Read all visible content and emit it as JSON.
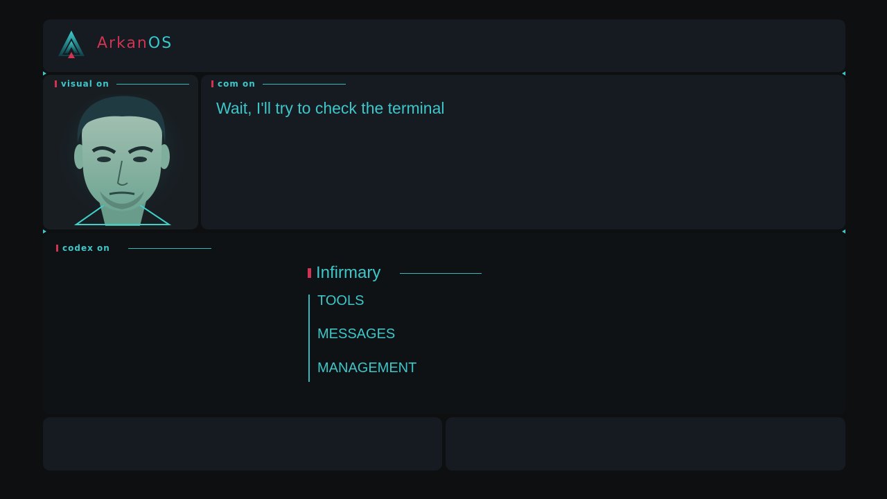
{
  "app": {
    "brand_part1": "Arkan",
    "brand_part2": "OS"
  },
  "panels": {
    "visual": {
      "label": "visual on"
    },
    "com": {
      "label": "com on",
      "message": "Wait, I'll try to check the terminal"
    },
    "codex": {
      "label": "codex on",
      "section_title": "Infirmary",
      "menu": [
        "TOOLS",
        "MESSAGES",
        "MANAGEMENT"
      ]
    }
  },
  "colors": {
    "accent": "#3fc6c9",
    "brand_red": "#d03452",
    "panel": "#151b21",
    "background": "#0d0f11"
  },
  "icons": {
    "logo": "arkan-triangle-logo",
    "avatar": "man-portrait-avatar"
  }
}
